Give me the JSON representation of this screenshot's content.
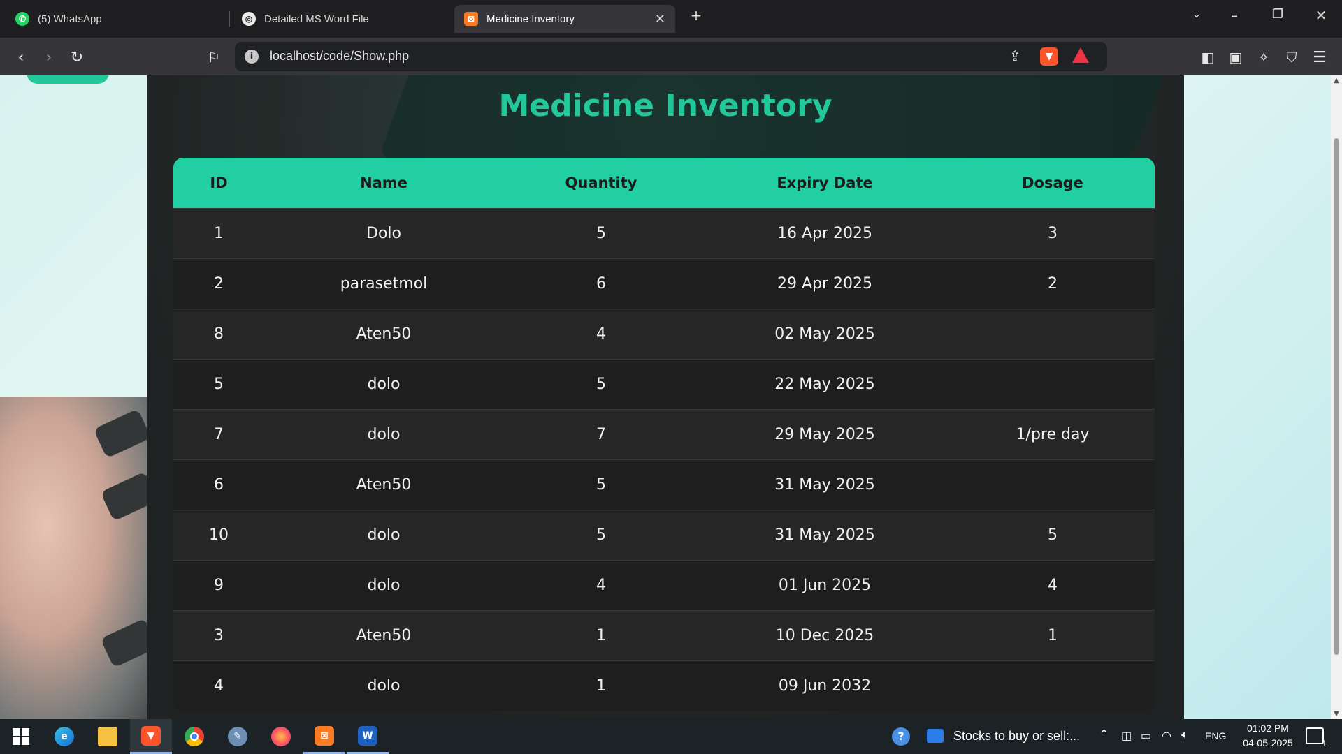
{
  "browser": {
    "tabs": [
      {
        "label": "(5) WhatsApp",
        "icon": "whatsapp-icon"
      },
      {
        "label": "Detailed MS Word File",
        "icon": "openai-icon"
      },
      {
        "label": "Medicine Inventory",
        "icon": "xampp-icon",
        "active": true
      }
    ],
    "url": "localhost/code/Show.php"
  },
  "page": {
    "title": "Medicine Inventory",
    "accent_color": "#22c79a",
    "table": {
      "headers": [
        "ID",
        "Name",
        "Quantity",
        "Expiry Date",
        "Dosage"
      ],
      "rows": [
        {
          "id": "1",
          "name": "Dolo",
          "quantity": "5",
          "expiry": "16 Apr 2025",
          "dosage": "3"
        },
        {
          "id": "2",
          "name": "parasetmol",
          "quantity": "6",
          "expiry": "29 Apr 2025",
          "dosage": "2"
        },
        {
          "id": "8",
          "name": "Aten50",
          "quantity": "4",
          "expiry": "02 May 2025",
          "dosage": ""
        },
        {
          "id": "5",
          "name": "dolo",
          "quantity": "5",
          "expiry": "22 May 2025",
          "dosage": ""
        },
        {
          "id": "7",
          "name": "dolo",
          "quantity": "7",
          "expiry": "29 May 2025",
          "dosage": "1/pre day"
        },
        {
          "id": "6",
          "name": "Aten50",
          "quantity": "5",
          "expiry": "31 May 2025",
          "dosage": ""
        },
        {
          "id": "10",
          "name": "dolo",
          "quantity": "5",
          "expiry": "31 May 2025",
          "dosage": "5"
        },
        {
          "id": "9",
          "name": "dolo",
          "quantity": "4",
          "expiry": "01 Jun 2025",
          "dosage": "4"
        },
        {
          "id": "3",
          "name": "Aten50",
          "quantity": "1",
          "expiry": "10 Dec 2025",
          "dosage": "1"
        },
        {
          "id": "4",
          "name": "dolo",
          "quantity": "1",
          "expiry": "09 Jun 2032",
          "dosage": ""
        }
      ]
    }
  },
  "taskbar": {
    "news": "Stocks to buy or sell:...",
    "lang": "ENG",
    "time": "01:02 PM",
    "date": "04-05-2025",
    "notifications": "1"
  }
}
